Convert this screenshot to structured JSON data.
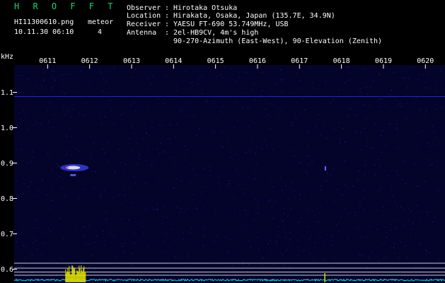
{
  "header": {
    "app_name": "H R O F F T",
    "filename": "HI11300610.png",
    "date_time": "10.11.30 06:10",
    "meteor_label": "meteor",
    "meteor_count": "4",
    "observer_label": "Observer",
    "observer_value": "Hirotaka Otsuka",
    "location_label": "Location",
    "location_value": "Hirakata, Osaka, Japan (135.7E, 34.9N)",
    "receiver_label": "Receiver",
    "receiver_value": "YAESU FT-690 53.749MHz, USB",
    "antenna_label": "Antenna",
    "antenna_value": "2el-HB9CV, 4m's high",
    "antenna_value_2": "90-270-Azimuth (East-West), 90-Elevation (Zenith)",
    "separator": ":"
  },
  "colors": {
    "title": "#19d36b",
    "text": "#ffffff",
    "background": "#000000",
    "plot_bg": "#04042a",
    "noise": "#2a2aa8",
    "echo": "#e0e000",
    "baseline": "#22c8e0",
    "tick": "#ffffff"
  },
  "chart_data": {
    "type": "heatmap",
    "yunit": "kHz",
    "x_ticks": [
      "0611",
      "0612",
      "0613",
      "0614",
      "0615",
      "0616",
      "0617",
      "0618",
      "0619",
      "0620"
    ],
    "y_ticks": [
      "1.1",
      "1.0",
      "0.9",
      "0.8",
      "0.7",
      "0.6"
    ],
    "y_tick_values": [
      1.1,
      1.0,
      0.9,
      0.8,
      0.7,
      0.6
    ],
    "xlim": [
      0,
      10
    ],
    "ylim": [
      0.58,
      1.195
    ],
    "horizontal_lines_khz": [
      0.617,
      0.603,
      0.592,
      0.583
    ],
    "echoes": [
      {
        "x": 1.64,
        "khz": 0.887,
        "strength": "strong"
      },
      {
        "x": 7.6,
        "khz": 0.885,
        "strength": "weak"
      }
    ]
  }
}
